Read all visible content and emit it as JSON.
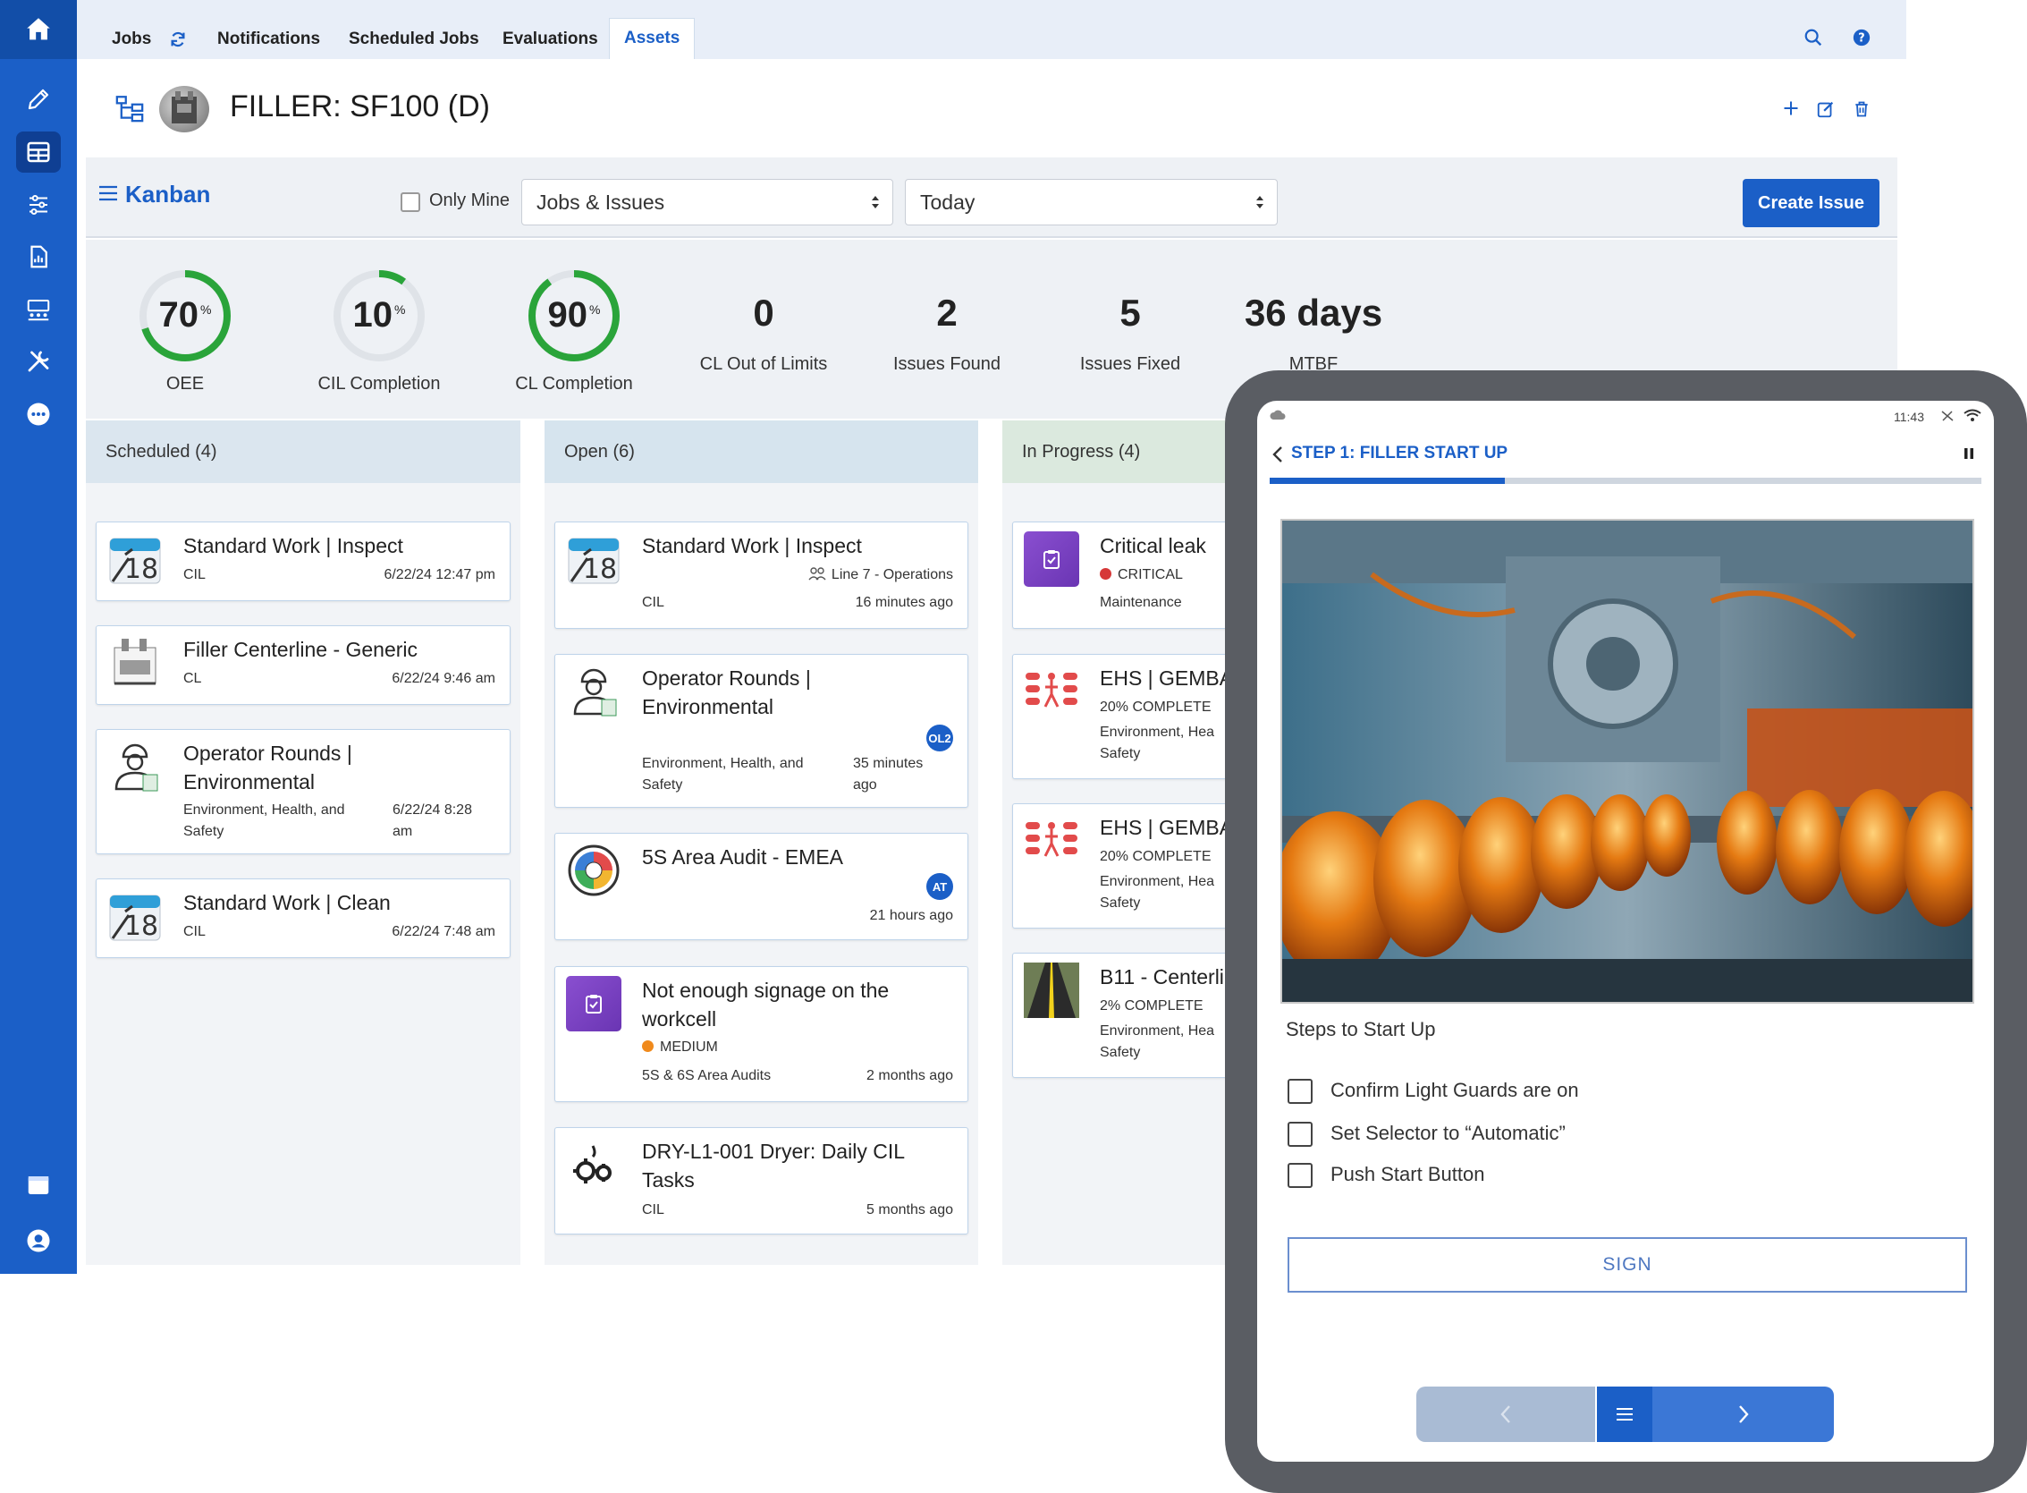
{
  "colors": {
    "brand": "#1b5fc7",
    "sidebar": "#1b5fc7",
    "gauge_ring": "#2aa43a",
    "critical": "#d63838",
    "medium": "#f08a1c"
  },
  "nav": {
    "tabs": [
      {
        "label": "Jobs"
      },
      {
        "label": "Notifications"
      },
      {
        "label": "Scheduled Jobs"
      },
      {
        "label": "Evaluations"
      },
      {
        "label": "Assets"
      }
    ],
    "active_tab": "Assets"
  },
  "sidebar_icons": [
    "home-icon",
    "pencil-icon",
    "grid-icon",
    "sliders-icon",
    "report-icon",
    "team-icon",
    "tools-icon",
    "more-icon",
    "calendar-icon",
    "user-icon"
  ],
  "asset": {
    "title": "FILLER: SF100 (D)"
  },
  "toolbar": {
    "view_title": "Kanban",
    "only_mine_label": "Only Mine",
    "filter_select": "Jobs & Issues",
    "date_select": "Today",
    "create_label": "Create Issue"
  },
  "kpis": {
    "gauges": [
      {
        "value": "70",
        "pct": 0.7,
        "unit": "%",
        "label": "OEE"
      },
      {
        "value": "10",
        "pct": 0.1,
        "unit": "%",
        "label": "CIL Completion"
      },
      {
        "value": "90",
        "pct": 0.9,
        "unit": "%",
        "label": "CL Completion"
      }
    ],
    "numbers": [
      {
        "value": "0",
        "label": "CL Out of Limits"
      },
      {
        "value": "2",
        "label": "Issues Found"
      },
      {
        "value": "5",
        "label": "Issues Fixed"
      },
      {
        "value": "36 days",
        "label": "MTBF"
      }
    ]
  },
  "columns": {
    "scheduled": {
      "header": "Scheduled (4)",
      "cards": [
        {
          "title": "Standard Work | Inspect",
          "type": "CIL",
          "date": "6/22/24 12:47 pm"
        },
        {
          "title": "Filler Centerline - Generic",
          "type": "CL",
          "date": "6/22/24 9:46 am"
        },
        {
          "title_1": "Operator Rounds |",
          "title_2": "Environmental",
          "type_1": "Environment, Health, and",
          "type_2": "Safety",
          "date_1": "6/22/24 8:28",
          "date_2": "am"
        },
        {
          "title": "Standard Work | Clean",
          "type": "CIL",
          "date": "6/22/24 7:48 am"
        }
      ]
    },
    "open": {
      "header": "Open (6)",
      "cards": [
        {
          "title": "Standard Work | Inspect",
          "line": "Line 7 - Operations",
          "type": "CIL",
          "time": "16 minutes ago"
        },
        {
          "title_1": "Operator Rounds |",
          "title_2": "Environmental",
          "badge": "OL2",
          "type_1": "Environment, Health, and",
          "type_2": "Safety",
          "time_1": "35 minutes",
          "time_2": "ago"
        },
        {
          "title": "5S Area Audit - EMEA",
          "badge": "AT",
          "time": "21 hours ago"
        },
        {
          "title_1": "Not enough signage on the",
          "title_2": "workcell",
          "severity": "MEDIUM",
          "type": "5S & 6S Area Audits",
          "time": "2 months ago"
        },
        {
          "title_1": "DRY-L1-001 Dryer: Daily CIL",
          "title_2": "Tasks",
          "type": "CIL",
          "time": "5 months ago"
        }
      ]
    },
    "in_progress": {
      "header": "In Progress (4)",
      "cards": [
        {
          "title": "Critical leak",
          "severity": "CRITICAL",
          "type": "Maintenance"
        },
        {
          "title": "EHS | GEMBA",
          "progress": "20% COMPLETE",
          "type_1": "Environment, Hea",
          "type_2": "Safety"
        },
        {
          "title": "EHS | GEMBA",
          "progress": "20% COMPLETE",
          "type_1": "Environment, Hea",
          "type_2": "Safety"
        },
        {
          "title": "B11 - Centerli",
          "progress": "2% COMPLETE",
          "type_1": "Environment, Hea",
          "type_2": "Safety"
        }
      ]
    }
  },
  "tablet": {
    "time": "11:43",
    "step_title": "STEP 1:  FILLER START UP",
    "progress": 0.33,
    "steps_title": "Steps to Start Up",
    "steps": [
      {
        "label": "Confirm Light Guards are on"
      },
      {
        "label": "Set Selector to “Automatic”"
      },
      {
        "label": "Push Start Button"
      }
    ],
    "sign_label": "SIGN"
  }
}
